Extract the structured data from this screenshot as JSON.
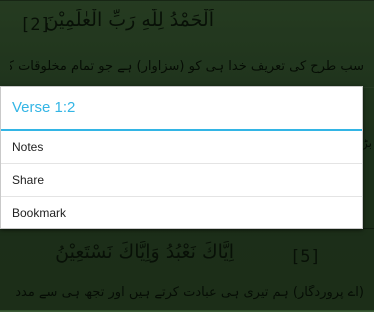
{
  "background": {
    "verses": [
      {
        "arabic": "اَلْحَمْدُ لِلّٰهِ رَبِّ الْعٰلَمِيْنَ",
        "number": "[2]",
        "translation": "سب طرح کی تعریف خدا ہی کو (سزاوار) ہے جو تمام مخلوقات کا پروردگار ہے"
      },
      {
        "arabic": "اِيَّاكَ نَعْبُدُ وَاِيَّاكَ نَسْتَعِيْنُ",
        "number": "[5]",
        "translation": "(اے پروردگار) ہم تیری ہی عبادت کرتے ہیں اور تجھ ہی سے مدد مانگتے ہیں"
      }
    ],
    "partial_line_char": "بڑ"
  },
  "dialog": {
    "title": "Verse 1:2",
    "items": [
      "Notes",
      "Share",
      "Bookmark"
    ]
  },
  "colors": {
    "accent": "#33b5e5",
    "background_green": "#2f4f2a"
  }
}
